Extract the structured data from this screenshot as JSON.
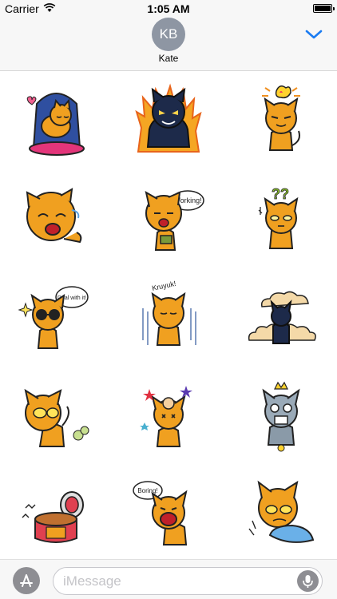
{
  "status_bar": {
    "carrier": "Carrier",
    "time": "1:05 AM"
  },
  "header": {
    "avatar_initials": "KB",
    "contact_name": "Kate",
    "collapse_icon": "chevron-down-icon"
  },
  "stickers": [
    {
      "id": "sleeping-cat-sticker",
      "caption": ""
    },
    {
      "id": "angry-black-cat-fire-sticker",
      "caption": ""
    },
    {
      "id": "idea-cat-sticker",
      "caption": ""
    },
    {
      "id": "crying-cat-sticker",
      "caption": ""
    },
    {
      "id": "working-cat-sticker",
      "caption": "Working!"
    },
    {
      "id": "confused-cat-sticker",
      "caption": ""
    },
    {
      "id": "cool-cat-sticker",
      "caption": "Deal with it!"
    },
    {
      "id": "shivering-cat-sticker",
      "caption": "Kruyuk!"
    },
    {
      "id": "black-cat-clouds-sticker",
      "caption": ""
    },
    {
      "id": "farting-cat-sticker",
      "caption": ""
    },
    {
      "id": "dizzy-cat-sticker",
      "caption": ""
    },
    {
      "id": "zombie-cat-sticker",
      "caption": ""
    },
    {
      "id": "canned-cat-sticker",
      "caption": ""
    },
    {
      "id": "bored-cat-sticker",
      "caption": "Boring!"
    },
    {
      "id": "blanket-cat-sticker",
      "caption": ""
    }
  ],
  "bottom_bar": {
    "message_placeholder": "iMessage",
    "message_value": ""
  },
  "colors": {
    "accent": "#1b7cf2",
    "cat_orange": "#f0a020",
    "outline": "#2a2a4a"
  }
}
